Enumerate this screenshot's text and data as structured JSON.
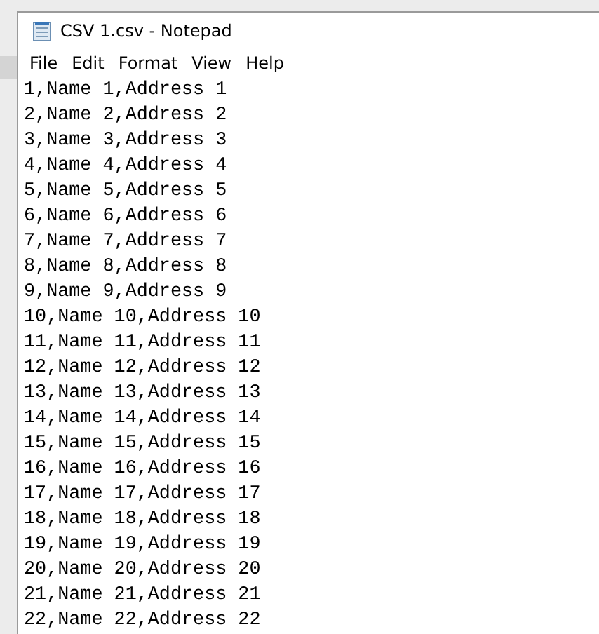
{
  "window": {
    "title": "CSV 1.csv - Notepad"
  },
  "menu": [
    "File",
    "Edit",
    "Format",
    "View",
    "Help"
  ],
  "lines": [
    "1,Name 1,Address 1",
    "2,Name 2,Address 2",
    "3,Name 3,Address 3",
    "4,Name 4,Address 4",
    "5,Name 5,Address 5",
    "6,Name 6,Address 6",
    "7,Name 7,Address 7",
    "8,Name 8,Address 8",
    "9,Name 9,Address 9",
    "10,Name 10,Address 10",
    "11,Name 11,Address 11",
    "12,Name 12,Address 12",
    "13,Name 13,Address 13",
    "14,Name 14,Address 14",
    "15,Name 15,Address 15",
    "16,Name 16,Address 16",
    "17,Name 17,Address 17",
    "18,Name 18,Address 18",
    "19,Name 19,Address 19",
    "20,Name 20,Address 20",
    "21,Name 21,Address 21",
    "22,Name 22,Address 22"
  ]
}
